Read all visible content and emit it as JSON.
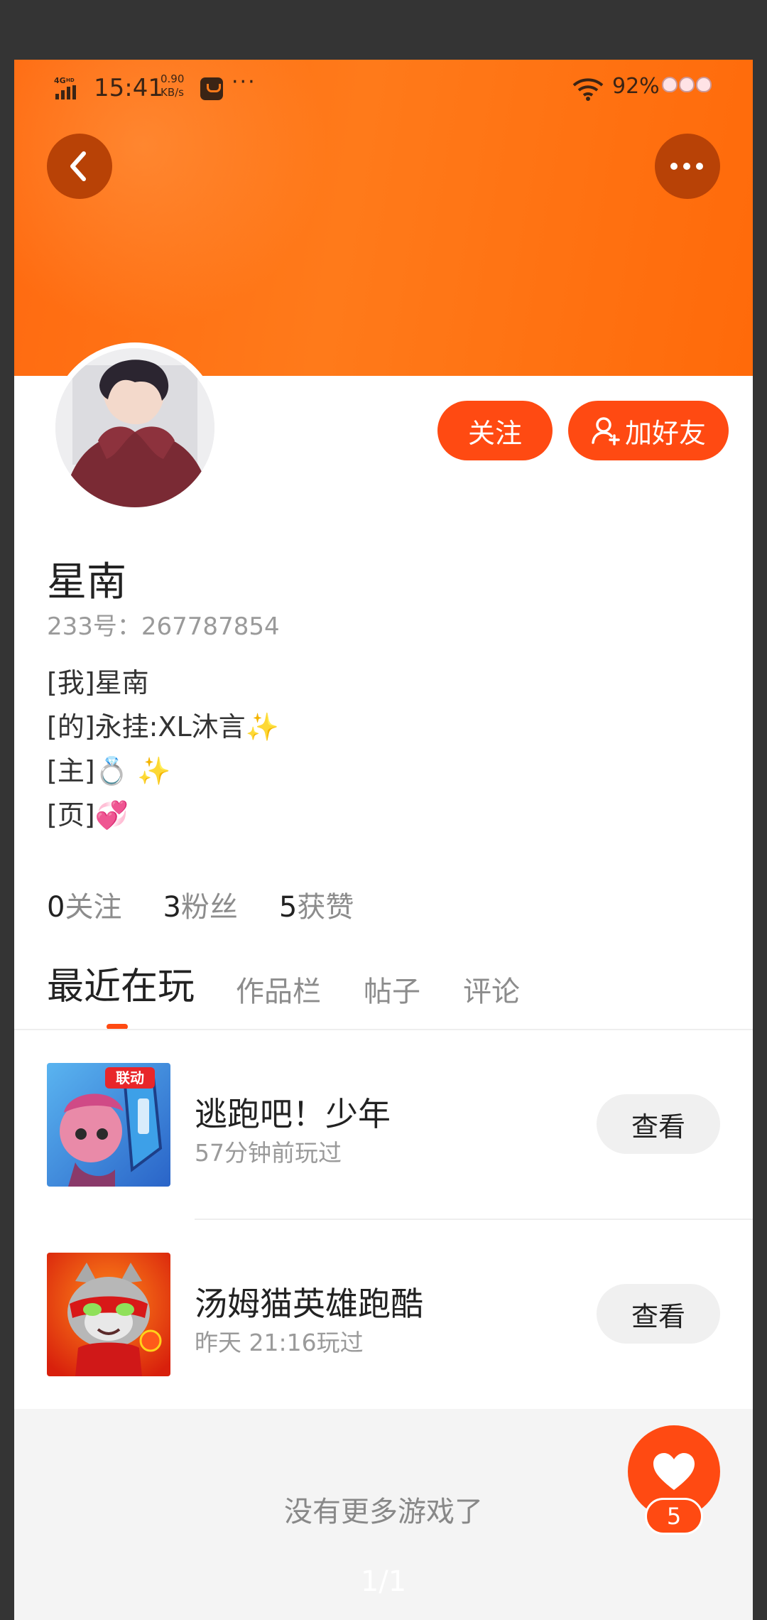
{
  "status_bar": {
    "network": "4GHD",
    "time": "15:41",
    "speed_value": "0.90",
    "speed_unit": "KB/s",
    "more": "···",
    "battery": "92%"
  },
  "header": {
    "back_icon": "chevron-left-icon",
    "more_icon": "more-dots-icon",
    "accent_color": "#ff6a10"
  },
  "profile": {
    "nickname": "星南",
    "id_label": "233号：",
    "id_value": "267787854",
    "follow_label": "关注",
    "add_friend_label": "加好友",
    "bio": [
      "[我]星南",
      "[的]永挂:XL沐言✨",
      "[主]💍 ✨",
      "[页]💞"
    ]
  },
  "stats": [
    {
      "num": "0",
      "label": "关注"
    },
    {
      "num": "3",
      "label": "粉丝"
    },
    {
      "num": "5",
      "label": "获赞"
    }
  ],
  "tabs": [
    "最近在玩",
    "作品栏",
    "帖子",
    "评论"
  ],
  "games": [
    {
      "name": "逃跑吧！少年",
      "time": "57分钟前玩过",
      "button": "查看",
      "badge": "联动"
    },
    {
      "name": "汤姆猫英雄跑酷",
      "time": "昨天  21:16玩过",
      "button": "查看"
    }
  ],
  "footer": {
    "no_more": "没有更多游戏了",
    "page_indicator": "1/1"
  },
  "like": {
    "icon": "heart-icon",
    "count": "5",
    "color": "#ff4a12"
  }
}
